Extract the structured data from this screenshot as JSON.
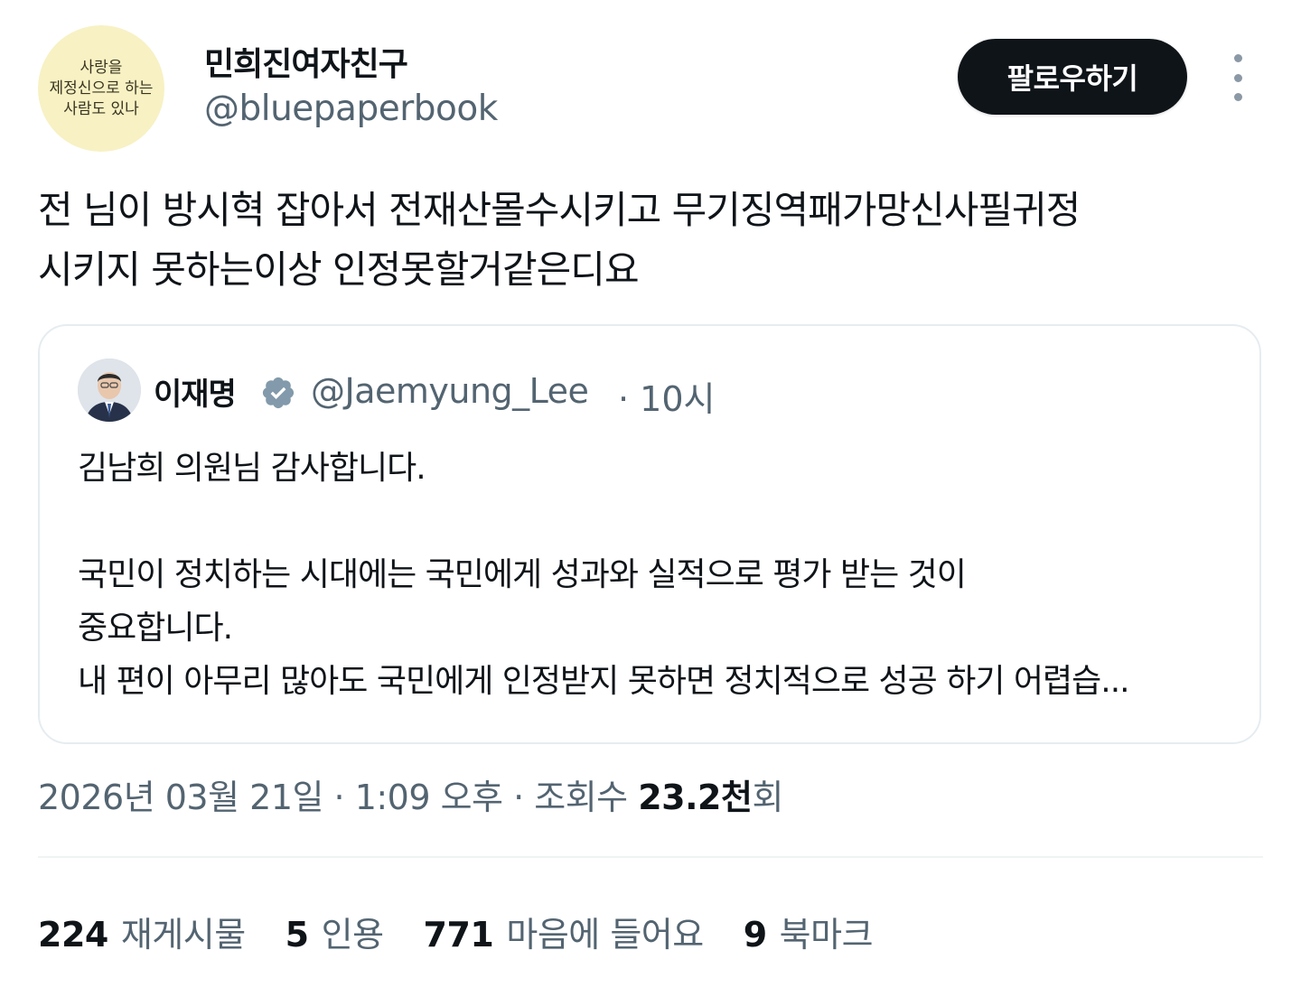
{
  "author": {
    "avatar_text": [
      "사랑을",
      "제정신으로 하는",
      "사람도 있나"
    ],
    "display_name": "민희진여자친구",
    "handle": "@bluepaperbook"
  },
  "header": {
    "follow_label": "팔로우하기",
    "more_icon": "more-vertical-icon"
  },
  "tweet": {
    "text": "전 님이 방시혁 잡아서 전재산몰수시키고 무기징역패가망신사필귀정\n시키지 못하는이상 인정못할거같은디요"
  },
  "quote": {
    "name": "이재명",
    "verified_icon": "verified-badge-icon",
    "handle": "@Jaemyung_Lee",
    "time": "· 10시",
    "text": "김남희 의원님 감사합니다.\n\n국민이 정치하는 시대에는 국민에게 성과와 실적으로 평가 받는 것이\n중요합니다.\n내 편이 아무리 많아도 국민에게 인정받지 못하면 정치적으로 성공 하기 어렵습..."
  },
  "meta": {
    "timestamp": "2026년 03월 21일 · 1:09 오후 · 조회수 ",
    "views": "23.2천",
    "views_suffix": "회"
  },
  "stats": [
    {
      "count": "224",
      "label": "재게시물"
    },
    {
      "count": "5",
      "label": "인용"
    },
    {
      "count": "771",
      "label": "마음에 들어요"
    },
    {
      "count": "9",
      "label": "북마크"
    }
  ],
  "colors": {
    "text_primary": "#0f1419",
    "text_secondary": "#536471",
    "verified_gray": "#829aab",
    "avatar_bg": "#f7f1c4"
  }
}
